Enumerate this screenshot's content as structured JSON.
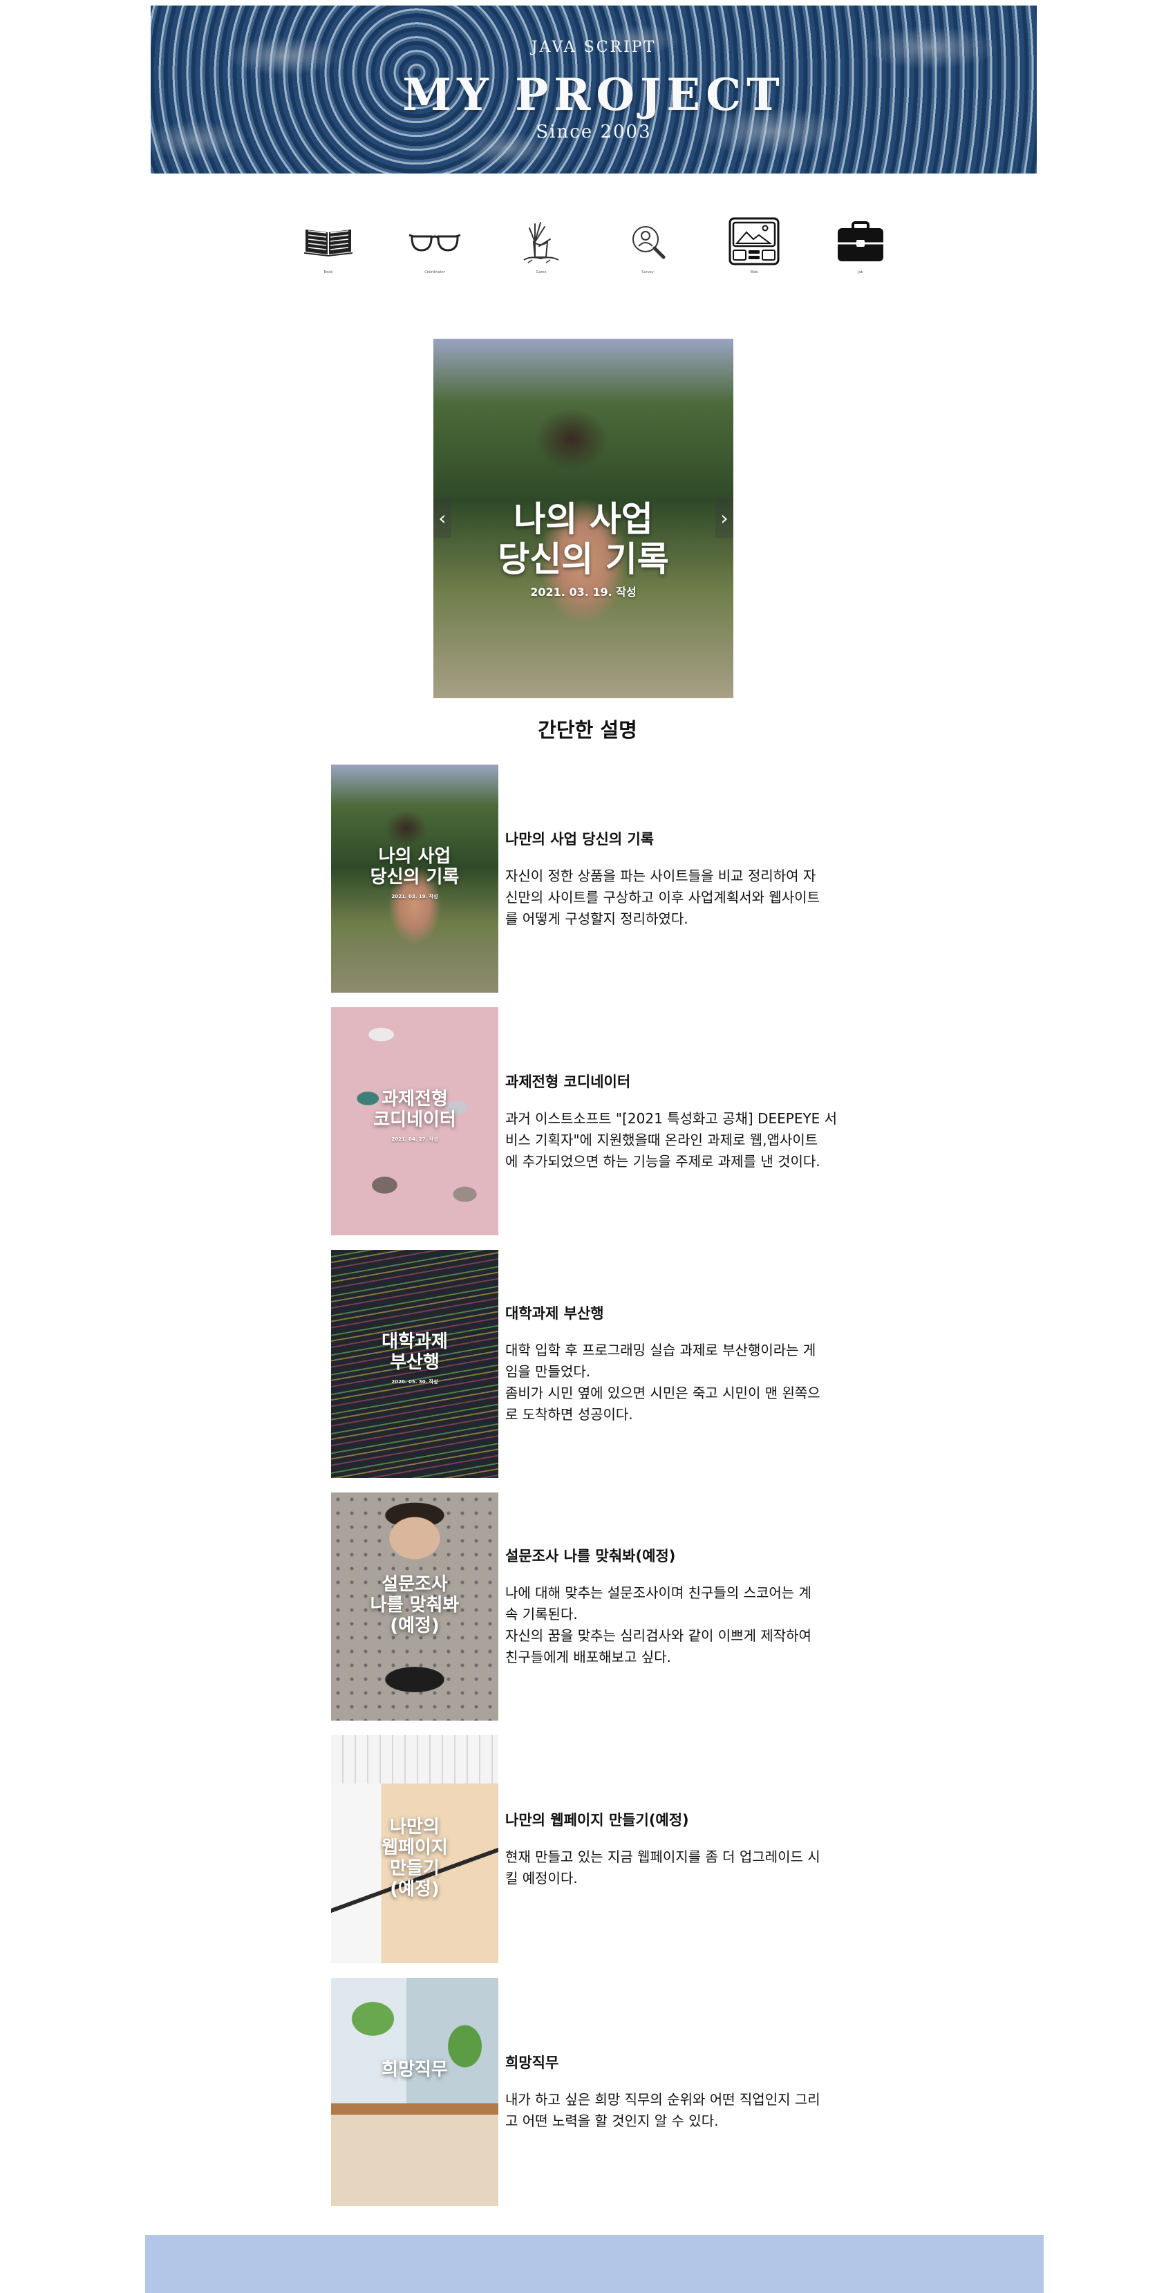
{
  "banner": {
    "top_text": "JAVA SCRIPT",
    "title": "MY PROJECT",
    "subtitle": "Since 2003"
  },
  "nav": {
    "items": [
      {
        "icon": "book-icon",
        "caption": "Book"
      },
      {
        "icon": "glasses-icon",
        "caption": "Coordinator"
      },
      {
        "icon": "zombie-hand-icon",
        "caption": "Game"
      },
      {
        "icon": "person-search-icon",
        "caption": "Survey"
      },
      {
        "icon": "web-browser-icon",
        "caption": "Web"
      },
      {
        "icon": "briefcase-icon",
        "caption": "Job"
      }
    ]
  },
  "hero": {
    "title": "나의 사업\n당신의 기록",
    "date": "2021. 03. 19. 작성",
    "prev_arrow": "‹",
    "next_arrow": "›"
  },
  "section": {
    "title": "간단한 설명"
  },
  "cards": [
    {
      "poster_title": "나의 사업\n당신의 기록",
      "poster_date": "2021. 03. 19. 작성",
      "title": "나만의 사업 당신의 기록",
      "desc": "자신이 정한 상품을 파는 사이트들을 비교 정리하여 자\n신만의 사이트를 구상하고 이후 사업계획서와 웹사이트\n를 어떻게 구성할지 정리하였다."
    },
    {
      "poster_title": "과제전형\n코디네이터",
      "poster_date": "2021. 04. 27. 작성",
      "title": "과제전형 코디네이터",
      "desc": "과거 이스트소프트 \"[2021 특성화고 공채] DEEPEYE 서\n비스 기획자\"에 지원했을때 온라인 과제로 웹,앱사이트\n에 추가되었으면 하는 기능을 주제로 과제를 낸 것이다."
    },
    {
      "poster_title": "대학과제\n부산행",
      "poster_date": "2020. 05. 30. 작성",
      "title": "대학과제 부산행",
      "desc": "대학 입학 후 프로그래밍 실습 과제로 부산행이라는 게\n임을 만들었다.\n좀비가 시민 옆에 있으면 시민은 죽고 시민이 맨 왼쪽으\n로 도착하면 성공이다."
    },
    {
      "poster_title": "설문조사\n나를 맞춰봐\n(예정)",
      "poster_date": "",
      "title": "설문조사 나를 맞춰봐(예정)",
      "desc": "나에 대해 맞추는 설문조사이며 친구들의 스코어는 계\n속 기록된다.\n자신의 꿈을 맞추는 심리검사와 같이 이쁘게 제작하여\n친구들에게 배포해보고 싶다."
    },
    {
      "poster_title": "나만의\n웹페이지\n만들기\n(예정)",
      "poster_date": "",
      "title": "나만의 웹페이지 만들기(예정)",
      "desc": "현재 만들고 있는 지금 웹페이지를 좀 더 업그레이드 시\n킬 예정이다."
    },
    {
      "poster_title": "희망직무",
      "poster_date": "",
      "title": "희망직무",
      "desc": "내가 하고 싶은 희망 직무의 순위와 어떤 직업인지 그리\n고 어떤 노력을 할 것인지 알 수 있다."
    }
  ],
  "colors": {
    "footer": "#b3c6e7",
    "banner_sea": "#2f5d8c"
  }
}
